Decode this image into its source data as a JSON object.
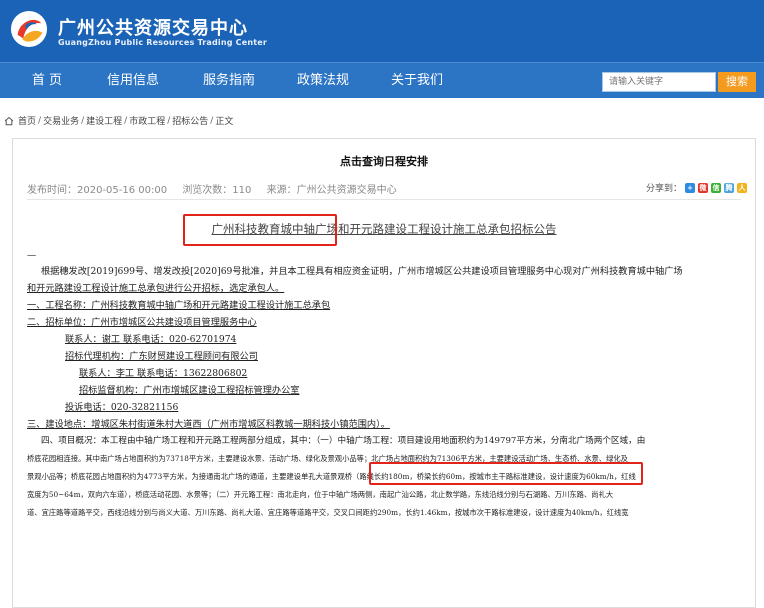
{
  "header": {
    "title": "广州公共资源交易中心",
    "subtitle": "GuangZhou Public Resources Trading Center"
  },
  "nav": {
    "items": [
      "首 页",
      "信用信息",
      "服务指南",
      "政策法规",
      "关于我们"
    ],
    "search_placeholder": "请输入关键字",
    "search_label": "搜索"
  },
  "breadcrumb": [
    "首页",
    "交易业务",
    "建设工程",
    "市政工程",
    "招标公告",
    "正文"
  ],
  "article": {
    "schedule_link": "点击查询日程安排",
    "publish_time": "发布时间：2020-05-16 00:00",
    "views": "浏览次数：110",
    "source": "来源：广州公共资源交易中心",
    "share_label": "分享到：",
    "share_icons": [
      "qzone-icon",
      "weibo-icon",
      "wechat-icon",
      "tencent-weibo-icon",
      "renren-icon"
    ],
    "doc_title": "广州科技教育城中轴广场和开元路建设工程设计施工总承包招标公告",
    "dash": "—",
    "lines": [
      "根据穗发改[2019]699号、增发改投[2020]69号批准，并且本工程具有相应资金证明，广州市增城区公共建设项目管理服务中心现对广州科技教育城中轴广场",
      "和开元路建设工程设计施工总承包进行公开招标，选定承包人。",
      "一、工程名称：广州科技教育城中轴广场和开元路建设工程设计施工总承包",
      "二、招标单位：广州市增城区公共建设项目管理服务中心",
      "联系人：谢工        联系电话：020-62701974",
      "招标代理机构：广东财贸建设工程顾问有限公司",
      "联系人：李工        联系电话：13622806802",
      "招标监督机构：广州市增城区建设工程招标管理办公室",
      "投诉电话：020-32821156",
      "三、建设地点：增城区朱村街道朱村大道西（广州市增城区科教城一期科技小镇范围内）。",
      "四、项目概况：本工程由中轴广场工程和开元路工程两部分组成，其中：（一）中轴广场工程：项目建设用地面积约为149797平方米，分南北广场两个区域，由",
      "桥底花园相连接。其中南广场占地面积约为73718平方米，主要建设水景、活动广场、绿化及景观小品等；北广场占地面积约为71306平方米，主要建设活动广场、生态桥、水景、绿化及",
      "景观小品等；桥底花园占地面积约为4773平方米，为接通南北广场的通道，主要建设单孔大道景观桥（路线长约180m，桥梁长约60m，按城市主干路标准建设，设计速度为60km/h，红线",
      "宽度为50~64m，双向六车道），桥底活动花园、水景等；（二）开元路工程：南北走向，位于中轴广场两侧，南起广汕公路，北止数学路，东线沿线分别与石湖路、万川东路、尚礼大",
      "道、宜庄路等道路平交，西线沿线分别与尚义大道、万川东路、尚礼大道、宜庄路等道路平交，交叉口间距约290m，长约1.46km，按城市次干路标准建设，设计速度为40km/h，红线宽"
    ]
  },
  "colors": {
    "header_bg": "#1b63b6",
    "nav_bg": "#2c74c4",
    "search_button": "#f39a1f",
    "highlight_box": "#e2231a"
  }
}
